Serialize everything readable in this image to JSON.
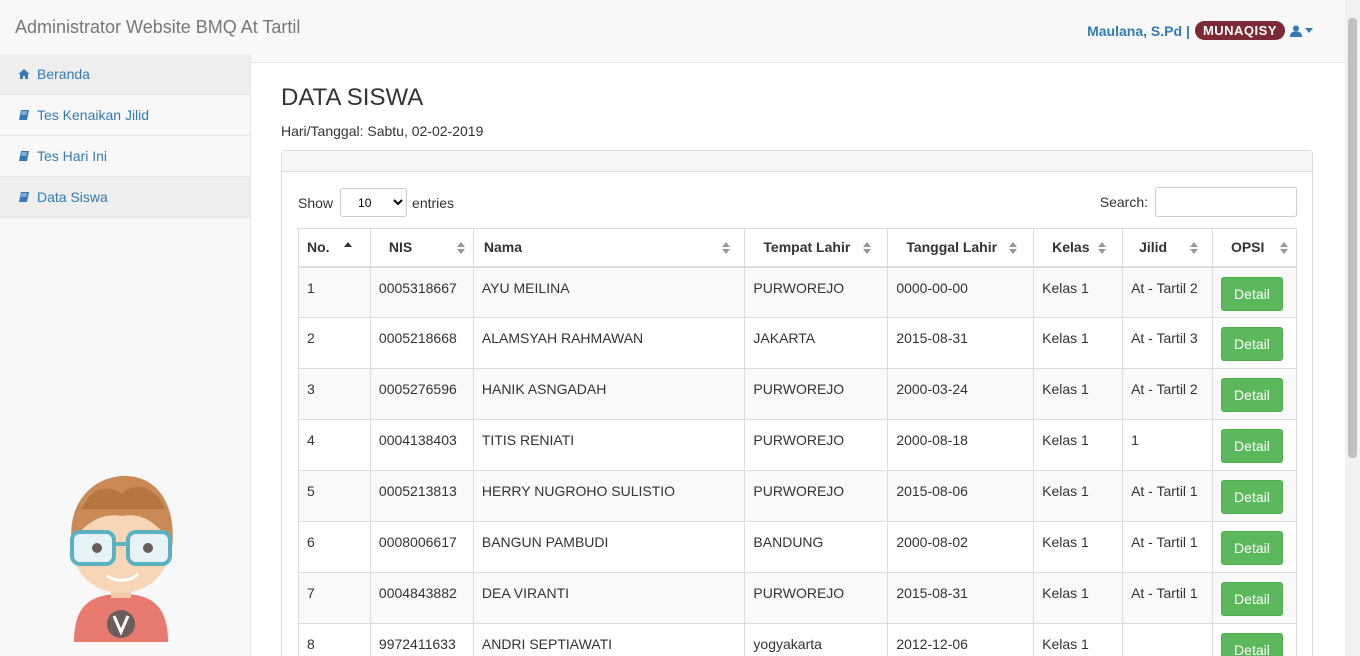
{
  "brand": "Administrator Website BMQ At Tartil",
  "user": {
    "name": "Maulana, S.Pd",
    "separator": "|",
    "role": "MUNAQISY",
    "icon": "user-icon"
  },
  "sidebar": {
    "items": [
      {
        "label": "Beranda",
        "icon": "home-icon"
      },
      {
        "label": "Tes Kenaikan Jilid",
        "icon": "book-icon"
      },
      {
        "label": "Tes Hari Ini",
        "icon": "book-icon"
      },
      {
        "label": "Data Siswa",
        "icon": "book-icon"
      }
    ]
  },
  "page": {
    "title": "DATA SISWA",
    "date": "Hari/Tanggal: Sabtu, 02-02-2019"
  },
  "table_controls": {
    "show": "Show",
    "length": "10",
    "entries": "entries",
    "search_label": "Search:"
  },
  "table": {
    "headers": [
      "No.",
      "NIS",
      "Nama",
      "Tempat Lahir",
      "Tanggal Lahir",
      "Kelas",
      "Jilid",
      "OPSI"
    ],
    "action_label": "Detail",
    "rows": [
      [
        "1",
        "0005318667",
        "AYU MEILINA",
        "PURWOREJO",
        "0000-00-00",
        "Kelas 1",
        "At - Tartil 2"
      ],
      [
        "2",
        "0005218668",
        "ALAMSYAH RAHMAWAN",
        "JAKARTA",
        "2015-08-31",
        "Kelas 1",
        "At - Tartil 3"
      ],
      [
        "3",
        "0005276596",
        "HANIK ASNGADAH",
        "PURWOREJO",
        "2000-03-24",
        "Kelas 1",
        "At - Tartil 2"
      ],
      [
        "4",
        "0004138403",
        "TITIS RENIATI",
        "PURWOREJO",
        "2000-08-18",
        "Kelas 1",
        "1"
      ],
      [
        "5",
        "0005213813",
        "HERRY NUGROHO SULISTIO",
        "PURWOREJO",
        "2015-08-06",
        "Kelas 1",
        "At - Tartil 1"
      ],
      [
        "6",
        "0008006617",
        "BANGUN PAMBUDI",
        "BANDUNG",
        "2000-08-02",
        "Kelas 1",
        "At - Tartil 1"
      ],
      [
        "7",
        "0004843882",
        "DEA VIRANTI",
        "PURWOREJO",
        "2015-08-31",
        "Kelas 1",
        "At - Tartil 1"
      ],
      [
        "8",
        "9972411633",
        "ANDRI SEPTIAWATI",
        "yogyakarta",
        "2012-12-06",
        "Kelas 1",
        ""
      ]
    ]
  }
}
